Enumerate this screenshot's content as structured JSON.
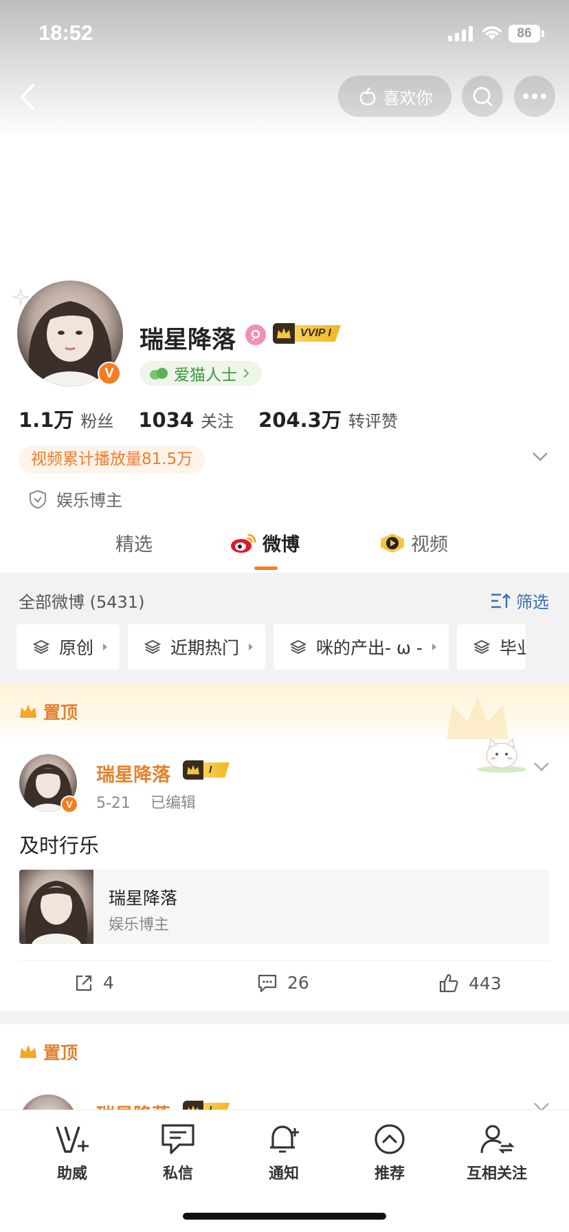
{
  "status_bar": {
    "time": "18:52",
    "battery": "86"
  },
  "header": {
    "like_label": "喜欢你"
  },
  "profile": {
    "name": "瑞星降落",
    "vip_label": "VVIP I",
    "category": "爱猫人士",
    "stats": [
      {
        "value": "1.1万",
        "label": "粉丝"
      },
      {
        "value": "1034",
        "label": "关注"
      },
      {
        "value": "204.3万",
        "label": "转评赞"
      }
    ],
    "play_count": "视频累计播放量81.5万",
    "role": "娱乐博主"
  },
  "tabs": [
    {
      "label": "精选"
    },
    {
      "label": "微博"
    },
    {
      "label": "视频"
    }
  ],
  "feed": {
    "header": "全部微博 (5431)",
    "filter_label": "筛选",
    "chips": [
      "原创",
      "近期热门",
      "咪的产出- ω -",
      "毕业记"
    ],
    "pinned_label": "置顶",
    "posts": [
      {
        "author": "瑞星降落",
        "level": "I",
        "date": "5-21",
        "edited": "已编辑",
        "text": "及时行乐",
        "share_title": "瑞星降落",
        "share_sub": "娱乐博主",
        "reposts": "4",
        "comments": "26",
        "likes": "443"
      },
      {
        "author": "瑞星降落",
        "level": "I"
      }
    ]
  },
  "bottom_nav": [
    {
      "label": "助威",
      "icon": "cheer-v-icon"
    },
    {
      "label": "私信",
      "icon": "message-icon"
    },
    {
      "label": "通知",
      "icon": "bell-icon"
    },
    {
      "label": "推荐",
      "icon": "recommend-icon"
    },
    {
      "label": "互相关注",
      "icon": "mutual-follow-icon"
    }
  ],
  "colors": {
    "accent": "#ff7a1a",
    "name_orange": "#e7812a",
    "link_blue": "#3c6db6",
    "green": "#3c9a3a"
  }
}
